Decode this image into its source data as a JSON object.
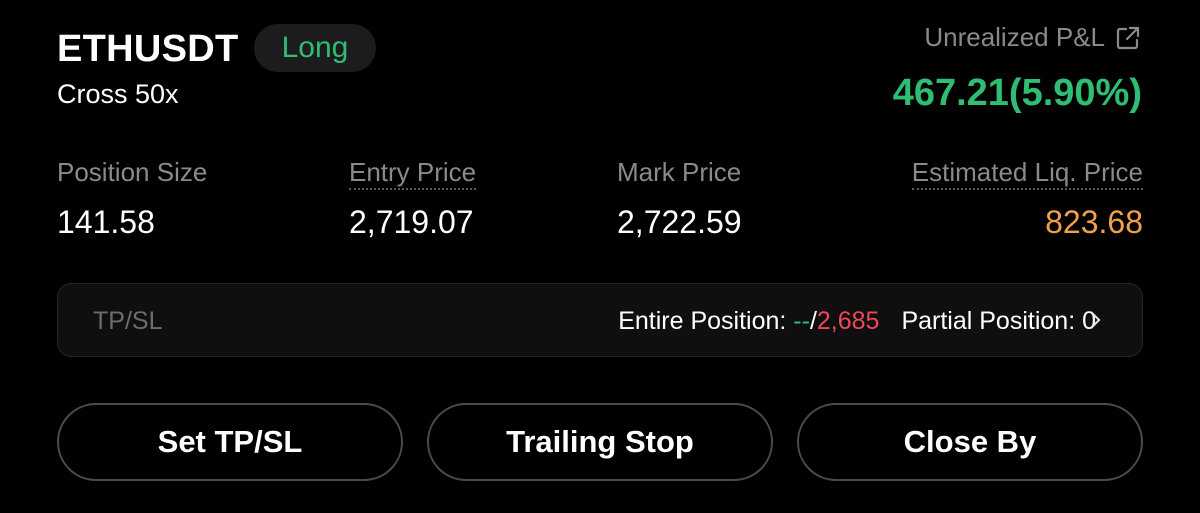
{
  "header": {
    "symbol": "ETHUSDT",
    "side": "Long",
    "margin_mode": "Cross 50x"
  },
  "pnl": {
    "label": "Unrealized P&L",
    "value": "467.21(5.90%)",
    "share_icon": "external-link-icon"
  },
  "stats": {
    "position_size": {
      "label": "Position Size",
      "value": "141.58"
    },
    "entry_price": {
      "label": "Entry Price",
      "value": "2,719.07"
    },
    "mark_price": {
      "label": "Mark Price",
      "value": "2,722.59"
    },
    "liq_price": {
      "label": "Estimated Liq. Price",
      "value": "823.68"
    }
  },
  "tpsl": {
    "label": "TP/SL",
    "entire_label": "Entire Position: ",
    "tp_value": "--",
    "separator": "/",
    "sl_value": "2,685",
    "partial_label": "Partial Position: ",
    "partial_value": "0",
    "chevron_icon": "chevron-right-icon"
  },
  "actions": {
    "set_tpsl": "Set TP/SL",
    "trailing_stop": "Trailing Stop",
    "close_by": "Close By"
  },
  "colors": {
    "positive": "#2ebd72",
    "negative": "#f0465a",
    "liquidation": "#f0a14a",
    "muted": "#8a8a8e"
  }
}
